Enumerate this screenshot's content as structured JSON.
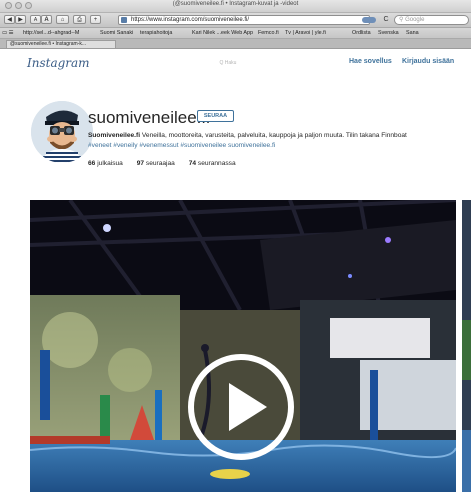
{
  "window": {
    "title": "(@suomiveneilee.fi • Instagram-kuvat ja -videot"
  },
  "toolbar": {
    "back": "◀",
    "forward": "▶",
    "text_small": "A",
    "text_large": "A",
    "home": "⌂",
    "print": "⎙",
    "add": "+",
    "url": "https://www.instagram.com/suomiveneilee.fi/",
    "reload": "C",
    "search_placeholder": "Google"
  },
  "bookmarks": [
    "http://sel...d--ahgrad--M",
    "Suomi Sanaki",
    "terapiahoitoja",
    "Kari Nilek ...eek Web App",
    "Femco.fi",
    "Tv | Aravoi | yle.fi",
    "Ordlista",
    "Svenska",
    "Sana"
  ],
  "tab": {
    "label": "@suomiveneilee.fi • Instagram-k..."
  },
  "ig": {
    "logo": "Instagram",
    "search_placeholder": "Q Haku",
    "get_app": "Hae sovellus",
    "login": "Kirjaudu sisään"
  },
  "profile": {
    "username": "suomiveneilee.fi",
    "follow": "SEURAA",
    "bio_name": "Suomiveneilee.fi",
    "bio_text": " Veneilla, moottoreita, varusteita, palveluita, kauppoja ja paljon muuta. Tilin takana Finnboat",
    "bio_tags": "#veneet #veneily #venemessut #suomiveneilee suomiveneilee.fi",
    "posts_count": "66",
    "posts_label": "julkaisua",
    "followers_count": "97",
    "followers_label": "seuraajaa",
    "following_count": "74",
    "following_label": "seurannassa"
  },
  "colors": {
    "link_blue": "#3f729b",
    "text": "#262626"
  }
}
